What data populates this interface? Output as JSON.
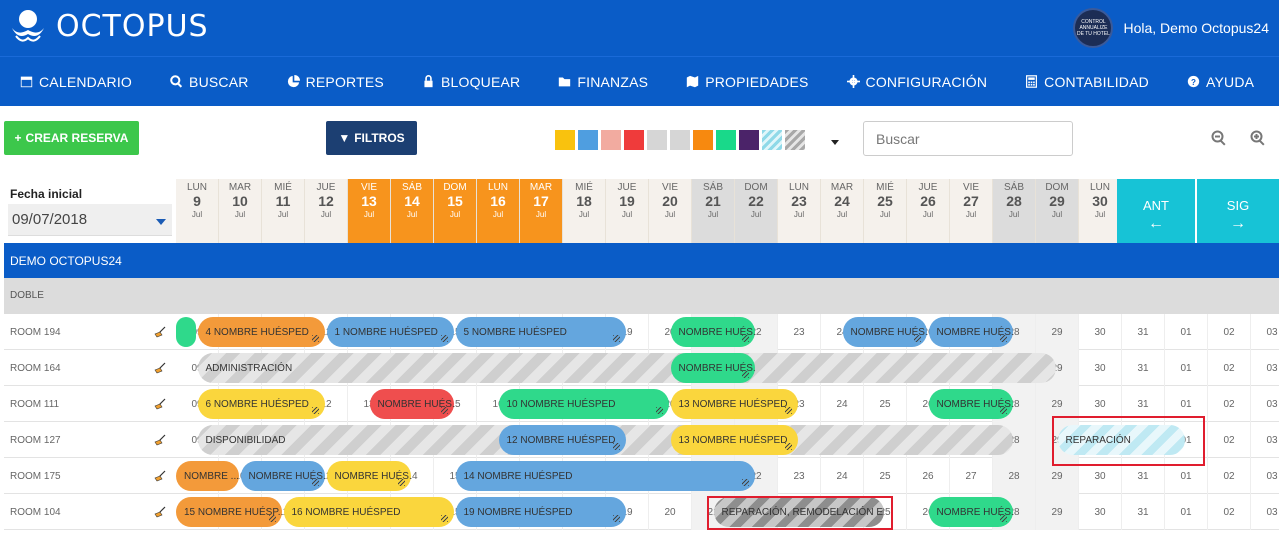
{
  "header": {
    "brand": "OCTOPUS",
    "greeting": "Hola, Demo Octopus24",
    "avatar_text": "CONTROL ANNUALIZE DE TU HOTEL",
    "accent": "#0a5cc7"
  },
  "nav": [
    {
      "label": "CALENDARIO",
      "icon": "calendar-icon"
    },
    {
      "label": "BUSCAR",
      "icon": "search-icon"
    },
    {
      "label": "REPORTES",
      "icon": "pie-chart-icon"
    },
    {
      "label": "BLOQUEAR",
      "icon": "lock-icon"
    },
    {
      "label": "FINANZAS",
      "icon": "folder-icon"
    },
    {
      "label": "PROPIEDADES",
      "icon": "map-icon"
    },
    {
      "label": "CONFIGURACIÓN",
      "icon": "gear-icon"
    },
    {
      "label": "CONTABILIDAD",
      "icon": "calculator-icon"
    },
    {
      "label": "AYUDA",
      "icon": "question-icon"
    }
  ],
  "toolbar": {
    "create_label": "CREAR RESERVA",
    "filter_label": "FILTROS",
    "search_placeholder": "Buscar",
    "swatches": [
      "#f9c20e",
      "#4f9ee0",
      "#f2aba0",
      "#ef3b3b",
      "#d6d6d6",
      "#d6d6d6",
      "#f7890f",
      "#19d98a",
      "#4b2369",
      "stripe-cyan",
      "stripe-gray"
    ]
  },
  "calendar": {
    "date_label": "Fecha inicial",
    "date_value": "09/07/2018",
    "prev_label": "ANT",
    "next_label": "SIG",
    "days": [
      {
        "n": "LUN",
        "d": "9",
        "m": "Jul",
        "t": ""
      },
      {
        "n": "MAR",
        "d": "10",
        "m": "Jul",
        "t": ""
      },
      {
        "n": "MIÉ",
        "d": "11",
        "m": "Jul",
        "t": ""
      },
      {
        "n": "JUE",
        "d": "12",
        "m": "Jul",
        "t": ""
      },
      {
        "n": "VIE",
        "d": "13",
        "m": "Jul",
        "t": "hl"
      },
      {
        "n": "SÁB",
        "d": "14",
        "m": "Jul",
        "t": "hl"
      },
      {
        "n": "DOM",
        "d": "15",
        "m": "Jul",
        "t": "hl"
      },
      {
        "n": "LUN",
        "d": "16",
        "m": "Jul",
        "t": "hl"
      },
      {
        "n": "MAR",
        "d": "17",
        "m": "Jul",
        "t": "hl"
      },
      {
        "n": "MIÉ",
        "d": "18",
        "m": "Jul",
        "t": ""
      },
      {
        "n": "JUE",
        "d": "19",
        "m": "Jul",
        "t": ""
      },
      {
        "n": "VIE",
        "d": "20",
        "m": "Jul",
        "t": ""
      },
      {
        "n": "SÁB",
        "d": "21",
        "m": "Jul",
        "t": "we"
      },
      {
        "n": "DOM",
        "d": "22",
        "m": "Jul",
        "t": "we"
      },
      {
        "n": "LUN",
        "d": "23",
        "m": "Jul",
        "t": ""
      },
      {
        "n": "MAR",
        "d": "24",
        "m": "Jul",
        "t": ""
      },
      {
        "n": "MIÉ",
        "d": "25",
        "m": "Jul",
        "t": ""
      },
      {
        "n": "JUE",
        "d": "26",
        "m": "Jul",
        "t": ""
      },
      {
        "n": "VIE",
        "d": "27",
        "m": "Jul",
        "t": ""
      },
      {
        "n": "SÁB",
        "d": "28",
        "m": "Jul",
        "t": "we"
      },
      {
        "n": "DOM",
        "d": "29",
        "m": "Jul",
        "t": "we"
      },
      {
        "n": "LUN",
        "d": "30",
        "m": "Jul",
        "t": ""
      }
    ],
    "group": "DEMO OCTOPUS24",
    "room_type": "DOBLE",
    "cell_labels": [
      "09",
      "10",
      "11",
      "12",
      "13",
      "14",
      "15",
      "16",
      "17",
      "18",
      "19",
      "20",
      "21",
      "22",
      "23",
      "24",
      "25",
      "26",
      "27",
      "28",
      "29",
      "30",
      "31",
      "01",
      "02",
      "03"
    ],
    "rooms": [
      {
        "name": "ROOM 194",
        "bars": [
          {
            "s": 0,
            "w": 0.5,
            "c": "c-green",
            "label": ""
          },
          {
            "s": 0.5,
            "w": 3,
            "c": "c-orange",
            "label": "4 NOMBRE HUÉSPED"
          },
          {
            "s": 3.5,
            "w": 3,
            "c": "c-blue",
            "label": "1 NOMBRE HUÉSPED"
          },
          {
            "s": 6.5,
            "w": 4,
            "c": "c-blue",
            "label": "5 NOMBRE HUÉSPED"
          },
          {
            "s": 11.5,
            "w": 2,
            "c": "c-green",
            "label": "NOMBRE HUÉS..."
          },
          {
            "s": 15.5,
            "w": 2,
            "c": "c-blue",
            "label": "NOMBRE HUÉS..."
          },
          {
            "s": 17.5,
            "w": 2,
            "c": "c-blue",
            "label": "NOMBRE HUÉS..."
          }
        ]
      },
      {
        "name": "ROOM 164",
        "bars": [
          {
            "s": 0.5,
            "w": 20,
            "c": "c-gray",
            "label": "ADMINISTRACIÓN"
          },
          {
            "s": 11.5,
            "w": 2,
            "c": "c-green",
            "label": "NOMBRE HUÉS..."
          }
        ]
      },
      {
        "name": "ROOM 111",
        "bars": [
          {
            "s": 0.5,
            "w": 3,
            "c": "c-yellow",
            "label": "6 NOMBRE HUÉSPED"
          },
          {
            "s": 4.5,
            "w": 2,
            "c": "c-red",
            "label": "NOMBRE HUÉS..."
          },
          {
            "s": 7.5,
            "w": 4,
            "c": "c-green",
            "label": "10 NOMBRE HUÉSPED"
          },
          {
            "s": 11.5,
            "w": 3,
            "c": "c-yellow",
            "label": "13 NOMBRE HUÉSPED"
          },
          {
            "s": 17.5,
            "w": 2,
            "c": "c-green",
            "label": "NOMBRE HUÉS..."
          }
        ]
      },
      {
        "name": "ROOM 127",
        "bars": [
          {
            "s": 0.5,
            "w": 19,
            "c": "c-gray",
            "label": "DISPONIBILIDAD"
          },
          {
            "s": 7.5,
            "w": 3,
            "c": "c-blue",
            "label": "12 NOMBRE HUÉSPED"
          },
          {
            "s": 11.5,
            "w": 3,
            "c": "c-yellow",
            "label": "13 NOMBRE HUÉSPED"
          },
          {
            "s": 20.5,
            "w": 3,
            "c": "c-stripe",
            "label": "REPARACIÓN"
          }
        ]
      },
      {
        "name": "ROOM 175",
        "bars": [
          {
            "s": 0,
            "w": 1.5,
            "c": "c-orange",
            "label": "NOMBRE ..."
          },
          {
            "s": 1.5,
            "w": 2,
            "c": "c-blue",
            "label": "NOMBRE HUÉS..."
          },
          {
            "s": 3.5,
            "w": 2,
            "c": "c-yellow",
            "label": "NOMBRE HUÉS..."
          },
          {
            "s": 6.5,
            "w": 7,
            "c": "c-blue",
            "label": "14 NOMBRE HUÉSPED"
          }
        ]
      },
      {
        "name": "ROOM 104",
        "bars": [
          {
            "s": 0,
            "w": 2.5,
            "c": "c-orange",
            "label": "15 NOMBRE HUÉSP..."
          },
          {
            "s": 2.5,
            "w": 4,
            "c": "c-yellow",
            "label": "16 NOMBRE HUÉSPED"
          },
          {
            "s": 6.5,
            "w": 4,
            "c": "c-blue",
            "label": "19 NOMBRE HUÉSPED"
          },
          {
            "s": 12.5,
            "w": 4,
            "c": "c-dark",
            "label": "REPARACIÓN, REMODELACIÓN ET"
          },
          {
            "s": 17.5,
            "w": 2,
            "c": "c-green",
            "label": "NOMBRE HUÉS..."
          }
        ]
      }
    ]
  }
}
